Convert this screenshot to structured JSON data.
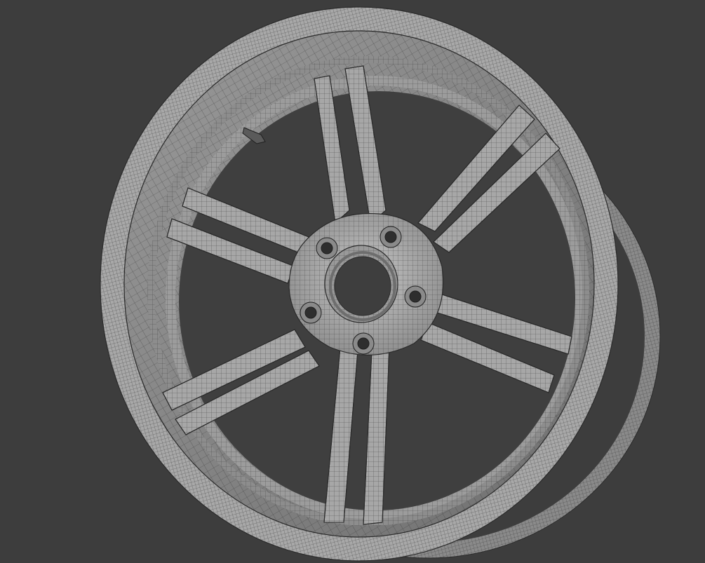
{
  "viewport": {
    "background": "#3d3d3d",
    "display_mode": "wireframe-overlay",
    "object": {
      "kind": "alloy-wheel",
      "spoke_count": 5,
      "spoke_style": "split-twin",
      "lug_nut_count": 5,
      "has_center_bore": true,
      "has_valve_stem": true
    },
    "colors": {
      "mesh_surface": "#a4a4a4",
      "mesh_shadow": "#5a5a5a",
      "wire": "#2a2a2a"
    }
  }
}
